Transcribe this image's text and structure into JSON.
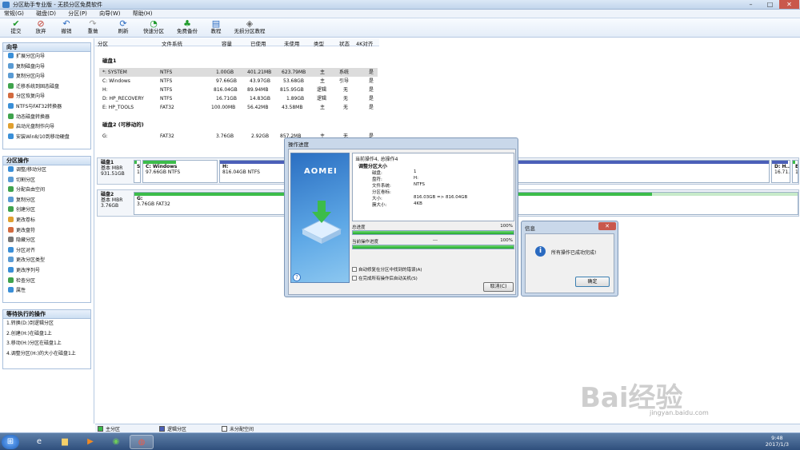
{
  "window": {
    "title": "分区助手专业版 - 无损分区免费软件",
    "controls": [
      "–",
      "□",
      "✕"
    ]
  },
  "menu": [
    "常规(G)",
    "磁盘(D)",
    "分区(P)",
    "向导(W)",
    "帮助(H)"
  ],
  "toolbar": [
    {
      "label": "提交",
      "icon": "✔",
      "color": "#1e9a2a"
    },
    {
      "label": "放弃",
      "icon": "⊘",
      "color": "#c0392b"
    },
    {
      "label": "撤销",
      "icon": "↶",
      "color": "#2a6ac0"
    },
    {
      "label": "重做",
      "icon": "↷",
      "color": "#999999"
    },
    {
      "label": "刷新",
      "icon": "⟳",
      "color": "#2a6ac0"
    },
    {
      "label": "快速分区",
      "icon": "◔",
      "color": "#1e9a2a"
    },
    {
      "label": "免费备份",
      "icon": "♣",
      "color": "#1e9a2a"
    },
    {
      "label": "教程",
      "icon": "▤",
      "color": "#2a6ac0"
    },
    {
      "label": "无损分区教程",
      "icon": "◈",
      "color": "#666666"
    }
  ],
  "sidebar": {
    "wizard": {
      "title": "向导",
      "items": [
        "扩展分区向导",
        "复制磁盘向导",
        "复制分区向导",
        "迁移系统到固态磁盘",
        "分区恢复向导",
        "NTFS与FAT32转换器",
        "动态磁盘转换器",
        "启动光盘制作向导",
        "安装Win8/10到移动硬盘"
      ]
    },
    "partition_ops": {
      "title": "分区操作",
      "items": [
        "调整/移动分区",
        "切割分区",
        "分配自由空间",
        "复制分区",
        "创建分区",
        "更改卷标",
        "更改盘符",
        "隐藏分区",
        "分区对齐",
        "更改分区类型",
        "更改序列号",
        "检查分区",
        "属性"
      ]
    },
    "pending": {
      "title": "等待执行的操作",
      "items": [
        "1.转换(D:)到逻辑分区",
        "2.创建(H:)在磁盘1上",
        "3.移动(H:)分区在磁盘1上",
        "4.调整分区(H:)的大小在磁盘1上"
      ]
    }
  },
  "grid": {
    "headers": [
      "分区",
      "文件系统",
      "容量",
      "已使用",
      "未使用",
      "类型",
      "状态",
      "4K对齐"
    ],
    "disk1_label": "磁盘1",
    "disk1_rows": [
      [
        "*: SYSTEM",
        "NTFS",
        "1.00GB",
        "401.21MB",
        "623.79MB",
        "主",
        "系统",
        "是"
      ],
      [
        "C: Windows",
        "NTFS",
        "97.66GB",
        "43.97GB",
        "53.68GB",
        "主",
        "引导",
        "是"
      ],
      [
        "H:",
        "NTFS",
        "816.04GB",
        "89.94MB",
        "815.95GB",
        "逻辑",
        "无",
        "是"
      ],
      [
        "D: HP_RECOVERY",
        "NTFS",
        "16.71GB",
        "14.83GB",
        "1.89GB",
        "逻辑",
        "无",
        "是"
      ],
      [
        "E: HP_TOOLS",
        "FAT32",
        "100.00MB",
        "56.42MB",
        "43.58MB",
        "主",
        "无",
        "是"
      ]
    ],
    "disk2_label": "磁盘2 (可移动的)",
    "disk2_rows": [
      [
        "G:",
        "FAT32",
        "3.76GB",
        "2.92GB",
        "857.2MB",
        "主",
        "无",
        "是"
      ]
    ]
  },
  "diskmap": {
    "disk1": {
      "name": "磁盘1",
      "type": "基本 MBR",
      "size": "931.51GB"
    },
    "disk1_segs": [
      {
        "l1": "S",
        "l2": "1",
        "fill": 0.4
      },
      {
        "l1": "C: Windows",
        "l2": "97.66GB NTFS",
        "fill": 0.45
      },
      {
        "l1": "H:",
        "l2": "816.04GB NTFS",
        "fill": 0.0
      },
      {
        "l1": "D: H...",
        "l2": "16.71...",
        "fill": 0.89
      },
      {
        "l1": "E:",
        "l2": "1...",
        "fill": 0.56
      }
    ],
    "disk2": {
      "name": "磁盘2",
      "type": "基本 MBR",
      "size": "3.76GB"
    },
    "disk2_seg": {
      "l1": "G:",
      "l2": "3.76GB FAT32",
      "fill": 0.78
    }
  },
  "progress_dialog": {
    "title": "操作进度",
    "logo": "AOMEI",
    "current": "当前操作4, 总操作4",
    "op_title": "调整分区大小",
    "fields": [
      {
        "k": "磁盘:",
        "v": "1"
      },
      {
        "k": "盘符:",
        "v": "H:"
      },
      {
        "k": "文件系统:",
        "v": "NTFS"
      },
      {
        "k": "分区卷标:",
        "v": ""
      },
      {
        "k": "大小:",
        "v": "816.03GB => 816.04GB"
      },
      {
        "k": "簇大小:",
        "v": "4KB"
      }
    ],
    "total_label": "总进度",
    "total_pct": "100%",
    "total_fill": 1.0,
    "cur_label": "当前操作进度",
    "cur_mid": "---",
    "cur_pct": "100%",
    "cur_fill": 1.0,
    "chk1": "自动修复在分区中找到的错误(A)",
    "chk2": "在完成所有操作后自动关机(S)",
    "help": "?",
    "cancel": "取消(C)"
  },
  "info_dialog": {
    "title": "信息",
    "message": "所有操作已成功完成!",
    "ok": "确定",
    "close": "✕"
  },
  "status": {
    "primary": "主分区",
    "logical": "逻辑分区",
    "free": "未分配空间"
  },
  "taskbar": {
    "time": "9:48",
    "date": "2017/1/3"
  },
  "watermark": {
    "brand": "Bai经验",
    "url": "jingyan.baidu.com"
  },
  "colors": {
    "primary_green": "#3cbc4a",
    "logical_blue": "#4b5fb8",
    "accent": "#2a6ac0"
  }
}
